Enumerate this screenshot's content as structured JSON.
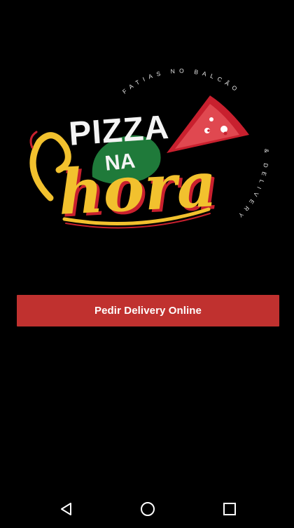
{
  "logo": {
    "arc_text_top": "FATIAS NO BALCÃO",
    "arc_text_side": "& DELIVERY",
    "word_pizza": "PIZZA",
    "word_na": "NA",
    "word_hora": "hora",
    "colors": {
      "yellow": "#f2c12e",
      "red": "#c8202e",
      "green": "#1f7a3a",
      "white": "#f4f4f4"
    }
  },
  "button": {
    "label": "Pedir Delivery Online",
    "color": "#c0312f"
  },
  "nav": {
    "back_icon": "triangle-back-icon",
    "home_icon": "circle-home-icon",
    "recents_icon": "square-recents-icon"
  }
}
